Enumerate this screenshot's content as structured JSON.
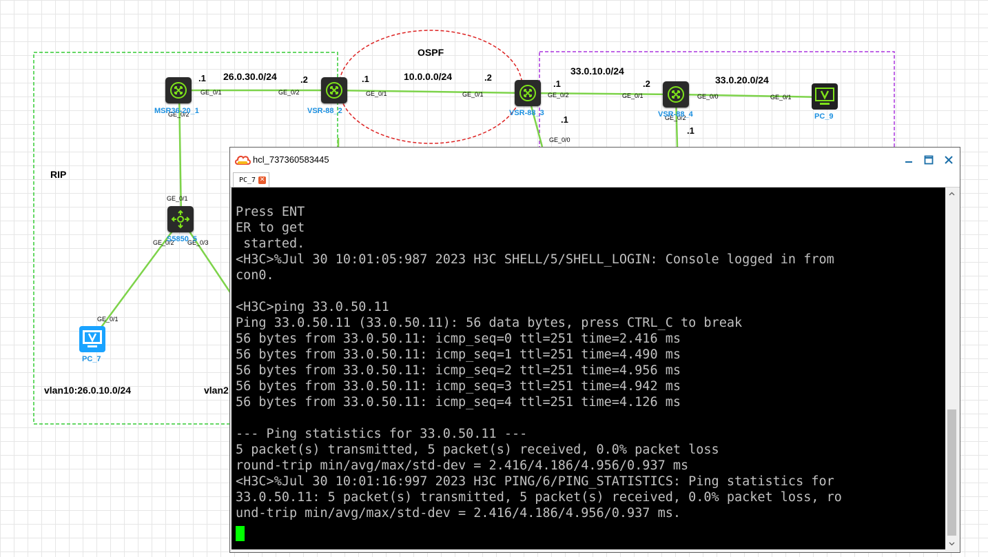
{
  "topology": {
    "zones": {
      "rip": "RIP",
      "ospf": "OSPF"
    },
    "networks": {
      "net1": "26.0.30.0/24",
      "net2": "10.0.0.0/24",
      "net3": "33.0.10.0/24",
      "net4": "33.0.20.0/24",
      "vlan10": "vlan10:26.0.10.0/24",
      "vlan2x": "vlan2"
    },
    "ips": {
      "msr_g01": ".1",
      "vsr2_g02": ".2",
      "vsr2_g01": ".1",
      "vsr3_g01": ".2",
      "vsr3_g02": ".1",
      "vsr4_g01": ".2",
      "vsr3_g00": ".1",
      "vsr4_g02": ".1"
    },
    "ports": {
      "msr_ge01": "GE_0/1",
      "msr_ge02": "GE_0/2",
      "vsr2_ge02": "GE_0/2",
      "vsr2_ge01": "GE_0/1",
      "vsr3_ge01": "GE_0/1",
      "vsr3_ge02": "GE_0/2",
      "vsr3_ge00": "GE_0/0",
      "vsr4_ge01": "GE_0/1",
      "vsr4_ge00": "GE_0/0",
      "vsr4_ge02": "GE_0/2",
      "pc9_ge01": "GE_0/1",
      "sw_ge01": "GE_0/1",
      "sw_ge02": "GE_0/2",
      "sw_ge03": "GE_0/3",
      "pc7_ge01": "GE_0/1"
    },
    "devices": {
      "msr": "MSR36-20_1",
      "vsr2": "VSR-88_2",
      "vsr3": "VSR-88_3",
      "vsr4": "VSR-88_4",
      "pc9": "PC_9",
      "sw": "S5850_5",
      "pc7": "PC_7"
    },
    "colors": {
      "link": "#7dd34a",
      "rip_border": "#33cc33",
      "ospf_border": "#dd2222",
      "right_border": "#aa33dd",
      "device_label": "#1a8fe0"
    }
  },
  "window": {
    "title": "hcl_737360583445",
    "tab_label": "PC_7",
    "buttons": {
      "minimize": "minimize",
      "maximize": "maximize",
      "close": "close"
    }
  },
  "console": {
    "lines": [
      "Press ENT",
      "ER to get",
      " started.",
      "<H3C>%Jul 30 10:01:05:987 2023 H3C SHELL/5/SHELL_LOGIN: Console logged in from",
      "con0.",
      "",
      "<H3C>ping 33.0.50.11",
      "Ping 33.0.50.11 (33.0.50.11): 56 data bytes, press CTRL_C to break",
      "56 bytes from 33.0.50.11: icmp_seq=0 ttl=251 time=2.416 ms",
      "56 bytes from 33.0.50.11: icmp_seq=1 ttl=251 time=4.490 ms",
      "56 bytes from 33.0.50.11: icmp_seq=2 ttl=251 time=4.956 ms",
      "56 bytes from 33.0.50.11: icmp_seq=3 ttl=251 time=4.942 ms",
      "56 bytes from 33.0.50.11: icmp_seq=4 ttl=251 time=4.126 ms",
      "",
      "--- Ping statistics for 33.0.50.11 ---",
      "5 packet(s) transmitted, 5 packet(s) received, 0.0% packet loss",
      "round-trip min/avg/max/std-dev = 2.416/4.186/4.956/0.937 ms",
      "<H3C>%Jul 30 10:01:16:997 2023 H3C PING/6/PING_STATISTICS: Ping statistics for",
      "33.0.50.11: 5 packet(s) transmitted, 5 packet(s) received, 0.0% packet loss, ro",
      "und-trip min/avg/max/std-dev = 2.416/4.186/4.956/0.937 ms."
    ]
  }
}
